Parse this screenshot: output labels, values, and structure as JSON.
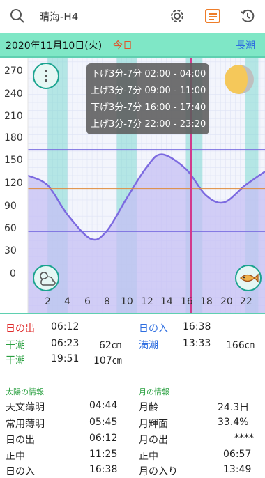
{
  "header": {
    "title": "晴海-H4",
    "icons": [
      "search-icon",
      "settings-gear-icon",
      "calendar-icon",
      "history-icon"
    ]
  },
  "datebar": {
    "date": "2020年11月10日(火)",
    "today": "今日",
    "tide_type": "長潮"
  },
  "chart": {
    "y_ticks": [
      "270",
      "240",
      "210",
      "180",
      "150",
      "120",
      "90",
      "60",
      "30",
      "0"
    ],
    "x_ticks": [
      "2",
      "4",
      "6",
      "8",
      "10",
      "12",
      "14",
      "16",
      "18",
      "20",
      "22"
    ],
    "tooltip": [
      "下げ3分-7分 02:00 - 04:00",
      "上げ3分-7分 09:00 - 11:00",
      "下げ3分-7分 16:00 - 17:40",
      "上げ3分-7分 22:00 - 23:20"
    ]
  },
  "chart_data": {
    "type": "area",
    "x": [
      0,
      2,
      4,
      6.38,
      8,
      10,
      12,
      13.55,
      16,
      18,
      19.85,
      22,
      24
    ],
    "y": [
      140,
      128,
      92,
      62,
      72,
      112,
      150,
      166,
      148,
      116,
      107,
      128,
      145
    ],
    "xlim": [
      0,
      24
    ],
    "ylim": [
      -30,
      285
    ],
    "x_ticks": [
      2,
      4,
      6,
      8,
      10,
      12,
      14,
      16,
      18,
      20,
      22
    ],
    "y_ticks": [
      0,
      30,
      60,
      90,
      120,
      150,
      180,
      210,
      240,
      270
    ],
    "current_time_marker": 16.5,
    "reference_lines": {
      "upper_purple": 172,
      "orange": 124,
      "lower_purple": 71
    },
    "colors": {
      "tide_fill": "#c6bff4",
      "tide_line": "#7c6ae0",
      "band": "#7fd8d2",
      "now_line": "#d23a8c"
    }
  },
  "bands_hours": [
    [
      2,
      4
    ],
    [
      9,
      11
    ],
    [
      16,
      17.67
    ],
    [
      22,
      23.33
    ]
  ],
  "sun_moon_tide": {
    "sunrise": {
      "label": "日の出",
      "time": "06:12"
    },
    "sunset": {
      "label": "日の入",
      "time": "16:38"
    },
    "low1": {
      "label": "干潮",
      "time": "06:23",
      "height": "62㎝"
    },
    "high1": {
      "label": "満潮",
      "time": "13:33",
      "height": "166㎝"
    },
    "low2": {
      "label": "干潮",
      "time": "19:51",
      "height": "107㎝"
    }
  },
  "sun_info": {
    "title": "太陽の情報",
    "rows": [
      {
        "label": "天文薄明",
        "value": "04:44"
      },
      {
        "label": "常用薄明",
        "value": "05:45"
      },
      {
        "label": "日の出",
        "value": "06:12"
      },
      {
        "label": "正中",
        "value": "11:25"
      },
      {
        "label": "日の入",
        "value": "16:38"
      }
    ]
  },
  "moon_info": {
    "title": "月の情報",
    "rows": [
      {
        "label": "月齢",
        "value": "24.3日"
      },
      {
        "label": "月輝面",
        "value": "33.4%"
      },
      {
        "label": "月の出",
        "value": "****"
      },
      {
        "label": "正中",
        "value": "06:57"
      },
      {
        "label": "月の入り",
        "value": "13:49"
      }
    ]
  }
}
